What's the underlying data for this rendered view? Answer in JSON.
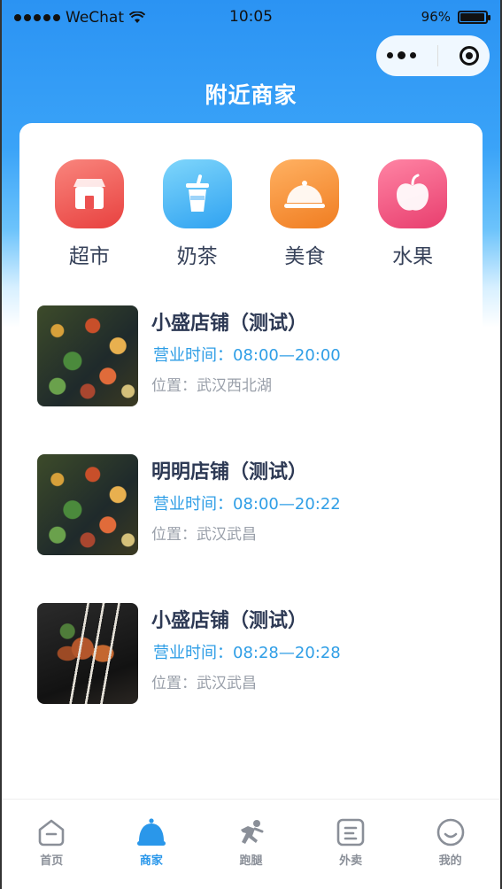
{
  "status_bar": {
    "carrier": "WeChat",
    "time": "10:05",
    "battery": "96%",
    "battery_level": 0.96
  },
  "header": {
    "title": "附近商家"
  },
  "categories": [
    {
      "label": "超市",
      "icon": "storefront-icon",
      "color": "#ec5150"
    },
    {
      "label": "奶茶",
      "icon": "milk-tea-cup-icon",
      "color": "#3eaaf3"
    },
    {
      "label": "美食",
      "icon": "food-cloche-icon",
      "color": "#f38a2c"
    },
    {
      "label": "水果",
      "icon": "apple-icon",
      "color": "#ec4b77"
    }
  ],
  "stores": [
    {
      "name": "小盛店铺（测试）",
      "hours": "营业时间：08:00—20:00",
      "location": "位置：武汉西北湖",
      "image": "market-photo"
    },
    {
      "name": "明明店铺（测试）",
      "hours": "营业时间：08:00—20:22",
      "location": "位置：武汉武昌",
      "image": "market-photo"
    },
    {
      "name": "小盛店铺（测试）",
      "hours": "营业时间：08:28—20:28",
      "location": "位置：武汉武昌",
      "image": "bbq-skewers-photo"
    }
  ],
  "tabbar": {
    "active": "商家",
    "items": [
      {
        "label": "首页",
        "icon": "home-icon"
      },
      {
        "label": "商家",
        "icon": "merchant-bell-icon"
      },
      {
        "label": "跑腿",
        "icon": "runner-icon"
      },
      {
        "label": "外卖",
        "icon": "delivery-box-icon"
      },
      {
        "label": "我的",
        "icon": "smile-face-icon"
      }
    ]
  },
  "colors": {
    "brand_blue": "#2b93f3",
    "tab_active": "#2a97ea",
    "hours_text": "#2f9ee6"
  }
}
